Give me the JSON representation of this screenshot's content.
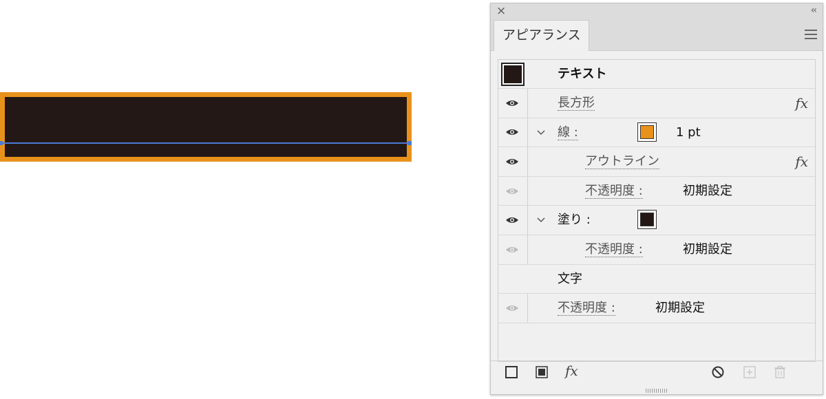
{
  "canvas": {
    "fill_color": "#231815",
    "stroke_color": "#e8921c",
    "selection_color": "#4a7bd6"
  },
  "panel": {
    "close_glyph": "×",
    "collapse_glyph": "‹‹",
    "tab_label": "アピアランス",
    "header": {
      "label": "テキスト"
    },
    "rows": {
      "rect": {
        "label": "長方形",
        "fx": "fx"
      },
      "stroke": {
        "label": "線 :",
        "value": "1 pt",
        "swatch_color": "#e8921c"
      },
      "outline": {
        "label": "アウトライン",
        "fx": "fx"
      },
      "stroke_opacity": {
        "label": "不透明度 :",
        "value": "初期設定"
      },
      "fill": {
        "label": "塗り :",
        "swatch_color": "#231815"
      },
      "fill_opacity": {
        "label": "不透明度 :",
        "value": "初期設定"
      },
      "chars": {
        "label": "文字"
      },
      "opacity": {
        "label": "不透明度 :",
        "value": "初期設定"
      }
    },
    "bottom": {
      "fx_label": "fx"
    }
  }
}
